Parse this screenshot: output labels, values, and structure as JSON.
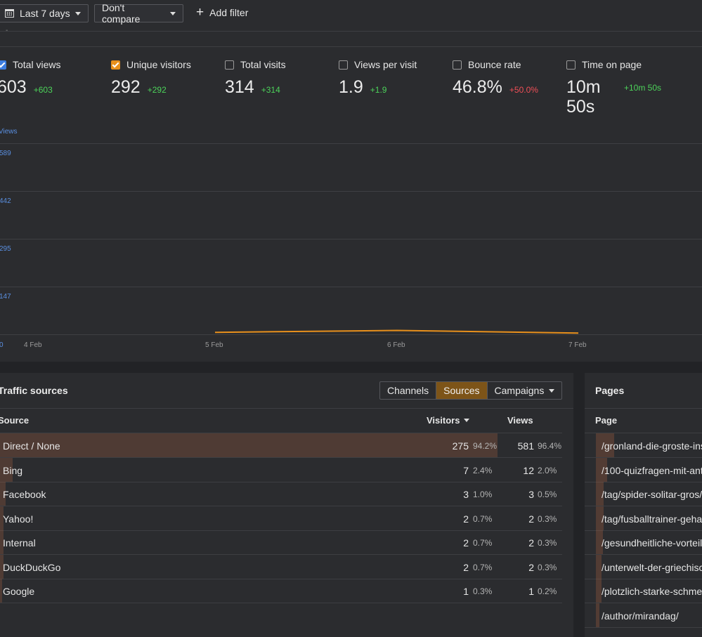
{
  "toolbar": {
    "date_range": "Last 7 days",
    "compare": "Don't compare",
    "add_filter": "Add filter"
  },
  "metrics": [
    {
      "label": "Total views",
      "value": "603",
      "delta": "+603",
      "checked": true,
      "color": "#3d7de0"
    },
    {
      "label": "Unique visitors",
      "value": "292",
      "delta": "+292",
      "checked": true,
      "color": "#e8901c"
    },
    {
      "label": "Total visits",
      "value": "314",
      "delta": "+314",
      "checked": false
    },
    {
      "label": "Views per visit",
      "value": "1.9",
      "delta": "+1.9",
      "checked": false
    },
    {
      "label": "Bounce rate",
      "value": "46.8%",
      "delta": "+50.0%",
      "checked": false
    },
    {
      "label": "Time on page",
      "value_line1": "10m",
      "value_line2": "50s",
      "delta": "+10m 50s",
      "checked": false
    }
  ],
  "chart_data": {
    "type": "line",
    "ylabel": "Views",
    "y_ticks": [
      "589",
      "442",
      "295",
      "147",
      "0"
    ],
    "ylim": [
      0,
      589
    ],
    "x": [
      "4 Feb",
      "5 Feb",
      "6 Feb",
      "7 Feb"
    ],
    "grid": true,
    "series": [
      {
        "color": "#e8901c",
        "values": [
          null,
          6,
          12,
          4
        ]
      }
    ]
  },
  "traffic": {
    "title": "Traffic sources",
    "tabs": [
      "Channels",
      "Sources",
      "Campaigns"
    ],
    "active_tab": "Sources",
    "col_source": "Source",
    "col_visitors": "Visitors",
    "col_views": "Views",
    "rows": [
      {
        "name": "Direct / None",
        "visitors": "275",
        "visitors_pct": "94.2%",
        "views": "581",
        "views_pct": "96.4%",
        "share": 0.942
      },
      {
        "name": "Bing",
        "visitors": "7",
        "visitors_pct": "2.4%",
        "views": "12",
        "views_pct": "2.0%",
        "share": 0.024
      },
      {
        "name": "Facebook",
        "visitors": "3",
        "visitors_pct": "1.0%",
        "views": "3",
        "views_pct": "0.5%",
        "share": 0.01
      },
      {
        "name": "Yahoo!",
        "visitors": "2",
        "visitors_pct": "0.7%",
        "views": "2",
        "views_pct": "0.3%",
        "share": 0.007
      },
      {
        "name": "Internal",
        "visitors": "2",
        "visitors_pct": "0.7%",
        "views": "2",
        "views_pct": "0.3%",
        "share": 0.007
      },
      {
        "name": "DuckDuckGo",
        "visitors": "2",
        "visitors_pct": "0.7%",
        "views": "2",
        "views_pct": "0.3%",
        "share": 0.007
      },
      {
        "name": "Google",
        "visitors": "1",
        "visitors_pct": "0.3%",
        "views": "1",
        "views_pct": "0.2%",
        "share": 0.003
      }
    ]
  },
  "pages": {
    "title": "Pages",
    "col_page": "Page",
    "rows": [
      {
        "path": "/gronland-die-groste-ins",
        "share": 0.16
      },
      {
        "path": "/100-quizfragen-mit-ant",
        "share": 0.1
      },
      {
        "path": "/tag/spider-solitar-gros/",
        "share": 0.07
      },
      {
        "path": "/tag/fusballtrainer-geha",
        "share": 0.07
      },
      {
        "path": "/gesundheitliche-vorteil",
        "share": 0.06
      },
      {
        "path": "/unterwelt-der-griechisc",
        "share": 0.05
      },
      {
        "path": "/plotzlich-starke-schme",
        "share": 0.05
      },
      {
        "path": "/author/mirandag/",
        "share": 0.03
      }
    ]
  }
}
